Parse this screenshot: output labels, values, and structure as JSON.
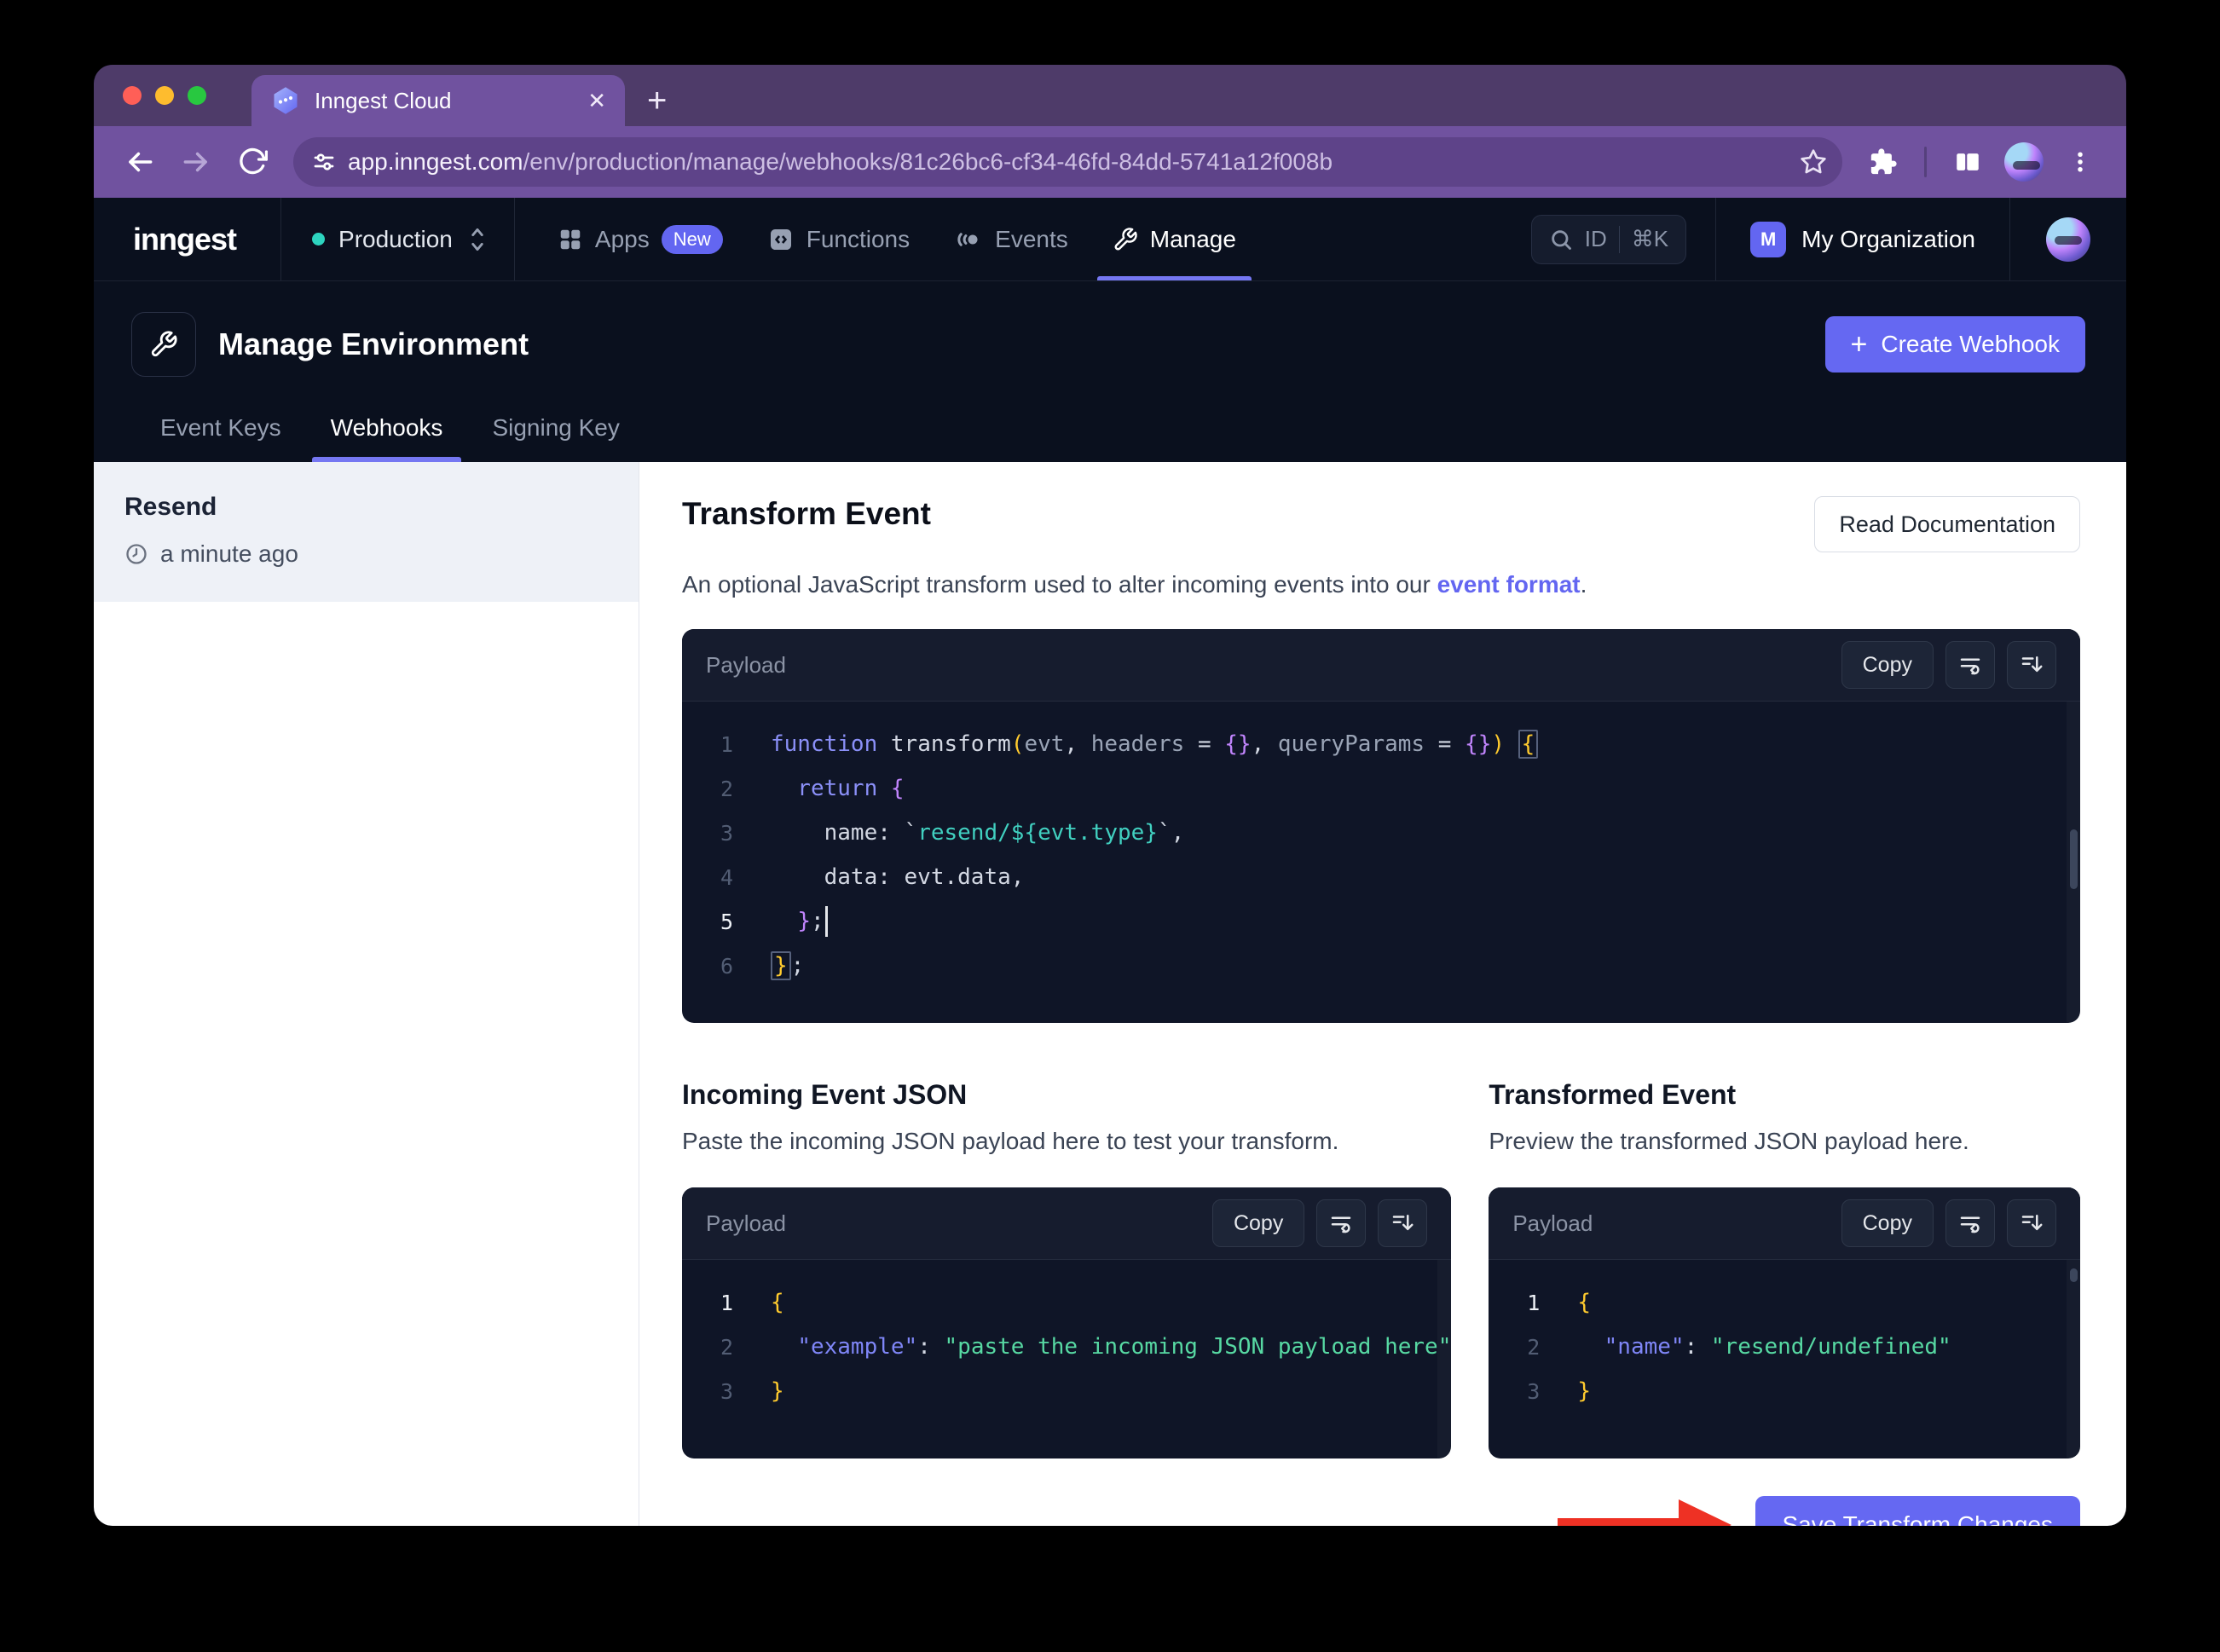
{
  "browser": {
    "tab_title": "Inngest Cloud",
    "close_x": "✕",
    "new_tab": "+",
    "url_host": "app.inngest.com",
    "url_path": "/env/production/manage/webhooks/81c26bc6-cf34-46fd-84dd-5741a12f008b"
  },
  "nav": {
    "logo": "inngest",
    "env": "Production",
    "apps": "Apps",
    "apps_badge": "New",
    "functions": "Functions",
    "events": "Events",
    "manage": "Manage",
    "search_id": "ID",
    "search_kbd": "⌘K",
    "org_initial": "M",
    "org_name": "My Organization"
  },
  "header": {
    "title": "Manage Environment",
    "create_plus": "+",
    "create_button": "Create Webhook",
    "tab_event_keys": "Event Keys",
    "tab_webhooks": "Webhooks",
    "tab_signing_key": "Signing Key"
  },
  "sidebar": {
    "webhook_name": "Resend",
    "webhook_time": "a minute ago"
  },
  "main": {
    "title": "Transform Event",
    "read_docs": "Read Documentation",
    "desc_before": "An optional JavaScript transform used to alter incoming events into our ",
    "desc_link": "event format",
    "desc_after": ".",
    "save_button": "Save Transform Changes"
  },
  "panels": {
    "label": "Payload",
    "copy": "Copy"
  },
  "incoming": {
    "title": "Incoming Event JSON",
    "desc": "Paste the incoming JSON payload here to test your transform."
  },
  "transformed": {
    "title": "Transformed Event",
    "desc": "Preview the transformed JSON payload here."
  },
  "transform_editor": {
    "lines": [
      {
        "no": "1",
        "t": [
          "function ",
          "transform",
          "(",
          "evt",
          ", ",
          "headers ",
          "= ",
          "{}",
          ", ",
          "queryParams ",
          "= ",
          "{}",
          ")",
          " ",
          "{"
        ]
      },
      {
        "no": "2",
        "t": [
          "  return ",
          "{"
        ]
      },
      {
        "no": "3",
        "t": [
          "    name: `",
          "resend/${evt.type}",
          "`,"
        ]
      },
      {
        "no": "4",
        "t": [
          "    data: evt.data,"
        ]
      },
      {
        "no": "5",
        "t": [
          "  ",
          "}",
          ";"
        ]
      },
      {
        "no": "6",
        "t": [
          "}",
          ";"
        ]
      }
    ]
  },
  "incoming_editor": {
    "lines": [
      {
        "no": "1",
        "t": [
          "{"
        ]
      },
      {
        "no": "2",
        "t": [
          "  ",
          "\"example\"",
          ": ",
          "\"paste the incoming JSON payload here\""
        ]
      },
      {
        "no": "3",
        "t": [
          "}"
        ]
      }
    ]
  },
  "transformed_editor": {
    "lines": [
      {
        "no": "1",
        "t": [
          "{"
        ]
      },
      {
        "no": "2",
        "t": [
          "  ",
          "\"name\"",
          ": ",
          "\"resend/undefined\""
        ]
      },
      {
        "no": "3",
        "t": [
          "}"
        ]
      }
    ]
  },
  "colors": {
    "accent": "#6366f1",
    "env_dot": "#2dd4bf",
    "annotation_arrow": "#ee3124"
  }
}
